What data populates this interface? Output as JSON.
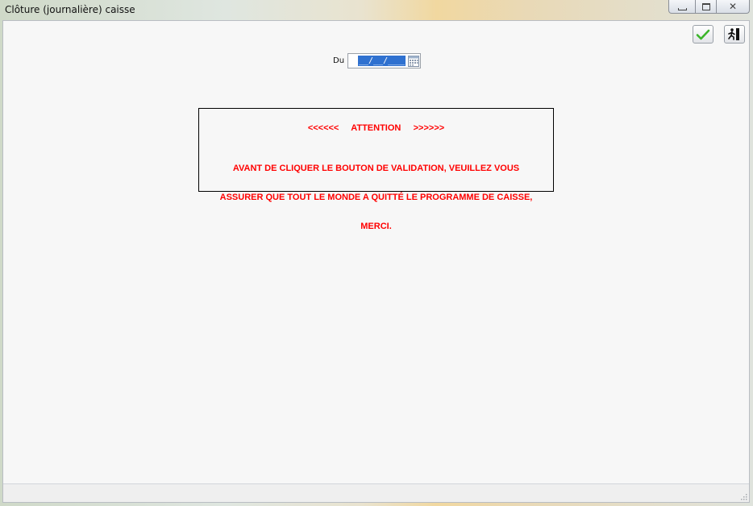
{
  "window": {
    "title": "Clôture (journalière) caisse",
    "minimize_icon": "minimize-icon",
    "maximize_icon": "maximize-icon",
    "close_icon": "close-icon",
    "close_glyph": "✕"
  },
  "toolbar": {
    "validate_icon": "checkmark-icon",
    "exit_icon": "exit-door-icon",
    "validate_color": "#3bb52a"
  },
  "form": {
    "date_label": "Du",
    "date_value": "__/__/____",
    "date_selection_color": "#2f71d0",
    "calendar_icon": "calendar-icon"
  },
  "warning": {
    "heading": "<<<<<<     ATTENTION     >>>>>>",
    "body_lines": [
      "AVANT DE CLIQUER LE BOUTON DE VALIDATION, VEUILLEZ VOUS",
      "ASSURER QUE TOUT LE MONDE A QUITTÉ LE PROGRAMME DE CAISSE,",
      "MERCI."
    ],
    "text_color": "#ff0000"
  }
}
